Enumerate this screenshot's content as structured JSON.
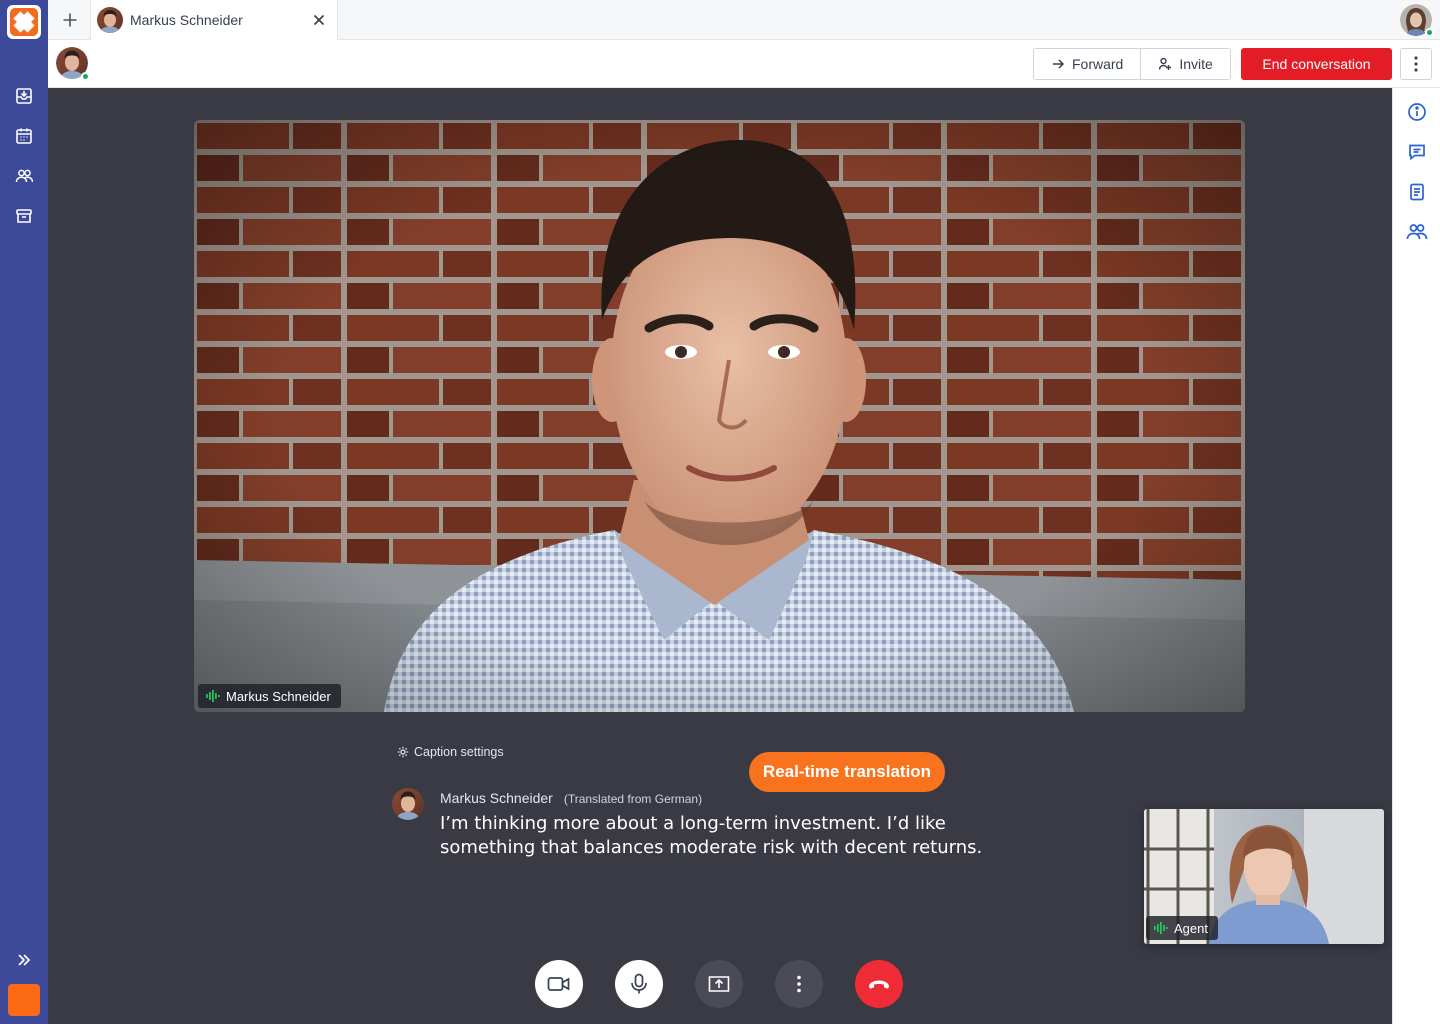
{
  "tabbar": {
    "tab_title": "Markus Schneider"
  },
  "toolbar": {
    "forward_label": "Forward",
    "invite_label": "Invite",
    "end_label": "End conversation"
  },
  "video": {
    "main_participant": "Markus Schneider",
    "pip_participant": "Agent"
  },
  "captions": {
    "settings_label": "Caption settings",
    "speaker": "Markus Schneider",
    "translation_note": "(Translated from German)",
    "text": "I’m thinking more about a long-term investment. I’d like something that balances moderate risk with decent returns."
  },
  "callout": {
    "label": "Real-time translation"
  },
  "colors": {
    "rail": "#3d4a9a",
    "brand_orange": "#f26b21",
    "end_red": "#e31c25",
    "stage": "#3a3a45",
    "accent_blue": "#2a63d8",
    "speaking_green": "#22c55e"
  }
}
